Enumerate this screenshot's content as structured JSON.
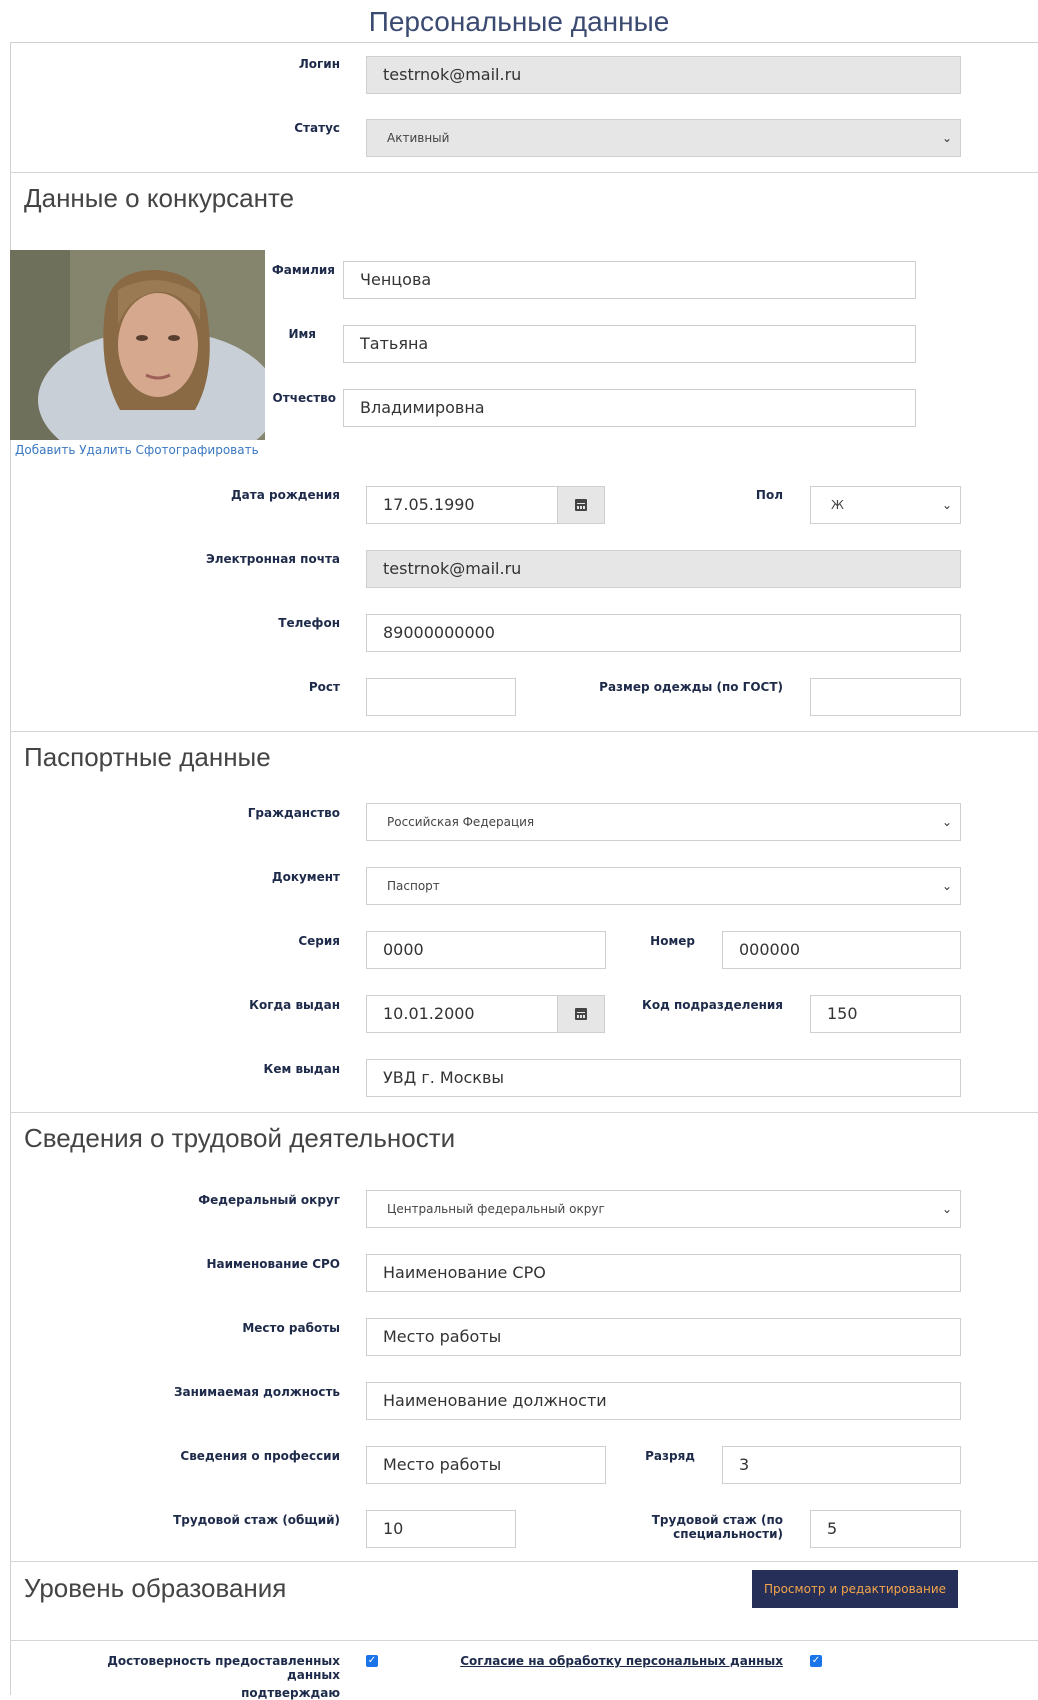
{
  "page": {
    "title": "Персональные данные"
  },
  "account": {
    "login_label": "Логин",
    "login_value": "testrnok@mail.ru",
    "status_label": "Статус",
    "status_value": "Активный"
  },
  "contestant": {
    "heading": "Данные о конкурсанте",
    "surname_label": "Фамилия",
    "surname_value": "Ченцова",
    "name_label": "Имя",
    "name_value": "Татьяна",
    "patronymic_label": "Отчество",
    "patronymic_value": "Владимировна",
    "photo_add": "Добавить",
    "photo_delete": "Удалить",
    "photo_take": "Сфотографировать",
    "birth_label": "Дата рождения",
    "birth_value": "17.05.1990",
    "gender_label": "Пол",
    "gender_value": "Ж",
    "email_label": "Электронная почта",
    "email_value": "testrnok@mail.ru",
    "phone_label": "Телефон",
    "phone_value": "89000000000",
    "height_label": "Рост",
    "height_value": "",
    "size_label": "Размер одежды (по ГОСТ)",
    "size_value": ""
  },
  "passport": {
    "heading": "Паспортные данные",
    "citizenship_label": "Гражданство",
    "citizenship_value": "Российская Федерация",
    "document_label": "Документ",
    "document_value": "Паспорт",
    "series_label": "Серия",
    "series_value": "0000",
    "number_label": "Номер",
    "number_value": "000000",
    "issued_label": "Когда выдан",
    "issued_value": "10.01.2000",
    "code_label": "Код подразделения",
    "code_value": "150",
    "issuer_label": "Кем выдан",
    "issuer_value": "УВД г. Москвы"
  },
  "work": {
    "heading": "Сведения о трудовой деятельности",
    "district_label": "Федеральный округ",
    "district_value": "Центральный федеральный округ",
    "sro_label": "Наименование СРО",
    "sro_value": "Наименование СРО",
    "workplace_label": "Место работы",
    "workplace_value": "Место работы",
    "position_label": "Занимаемая должность",
    "position_value": "Наименование должности",
    "profession_label": "Сведения о профессии",
    "profession_value": "Место работы",
    "grade_label": "Разряд",
    "grade_value": "3",
    "exp_total_label": "Трудовой стаж (общий)",
    "exp_total_value": "10",
    "exp_spec_label": "Трудовой стаж (по специальности)",
    "exp_spec_value": "5"
  },
  "education": {
    "heading": "Уровень образования",
    "button_label": "Просмотр и редактирование"
  },
  "consent": {
    "accuracy_line1": "Достоверность предоставленных данных",
    "accuracy_line2": "подтверждаю",
    "processing_label": "Согласие на обработку персональных данных"
  },
  "colors": {
    "accent_button": "#262f57",
    "button_text": "#f5a54a",
    "link": "#3a78c2",
    "checkbox": "#1a73e8"
  }
}
